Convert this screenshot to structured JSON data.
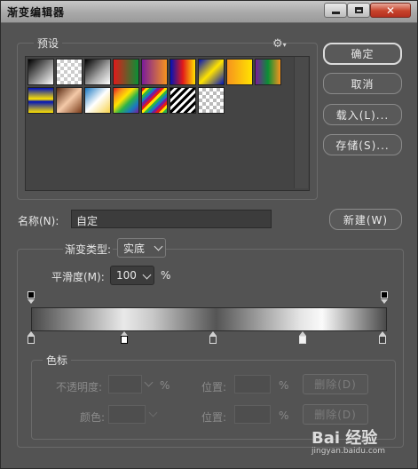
{
  "window": {
    "title": "渐变编辑器",
    "close_glyph": "✕"
  },
  "presets": {
    "label": "预设",
    "menu_icon": "gear-icon",
    "swatches": [
      "linear-gradient(135deg,#000 0%,#fff 100%)",
      "repeating-conic-gradient(#ccc 0 25%, #fff 0 50%) 0 0/8px 8px",
      "linear-gradient(135deg,#000 0%,#aaa 60%, #fff 100%)",
      "linear-gradient(90deg,#e21a1a 0%,#0a8f35 100%)",
      "linear-gradient(90deg,#7a1c9a 0%,#f7931e 100%)",
      "linear-gradient(90deg,#0012b8 0%,#e21a1a 50%,#ffe300 100%)",
      "linear-gradient(135deg,#0012b8 0%,#ffe300 50%,#0012b8 100%)",
      "linear-gradient(90deg,#f7931e 0%,#ffe300 100%)",
      "linear-gradient(90deg,#7a1c9a 0%,#0a8f35 50%,#f7931e 100%)",
      "linear-gradient(0deg,#ffe300 0%,#0012b8 45%,#ffe300 55%,#0012b8 100%)",
      "linear-gradient(135deg,#5a2b12 0%,#f4c9a8 50%,#7a3c1a 100%)",
      "linear-gradient(135deg,#1a78c2 0%,#fff 50%,#f7d24a 100%)",
      "linear-gradient(135deg,#e21a1a,#f7931e,#ffe300,#2bb34a,#1a78c2,#7a1c9a)",
      "repeating-linear-gradient(135deg,#e21a1a 0 3px,#ffe300 3px 6px,#2bb34a 6px 9px,#1a78c2 9px 12px,#7a1c9a 12px 15px)",
      "repeating-linear-gradient(135deg,#000 0 3px,#fff 3px 6px)",
      "repeating-conic-gradient(#bbb 0 25%, #fff 0 50%) 0 0/8px 8px"
    ]
  },
  "buttons": {
    "ok": "确定",
    "cancel": "取消",
    "load": "载入(L)...",
    "save": "存储(S)...",
    "new": "新建(W)"
  },
  "name": {
    "label": "名称(N):",
    "value": "自定"
  },
  "gradient": {
    "type_label": "渐变类型:",
    "type_value": "实底",
    "smooth_label": "平滑度(M):",
    "smooth_value": "100",
    "smooth_unit": "%"
  },
  "color_stops": {
    "group_label": "色标",
    "opacity_label": "不透明度:",
    "opacity_value": "",
    "opacity_unit": "%",
    "position_label_1": "位置:",
    "position_value_1": "",
    "position_unit_1": "%",
    "delete_label_1": "删除(D)",
    "color_label": "颜色:",
    "position_label_2": "位置:",
    "position_value_2": "",
    "position_unit_2": "%",
    "delete_label_2": "删除(D)"
  },
  "watermark": {
    "text": "Bai 经验",
    "sub": "jingyan.baidu.com"
  }
}
